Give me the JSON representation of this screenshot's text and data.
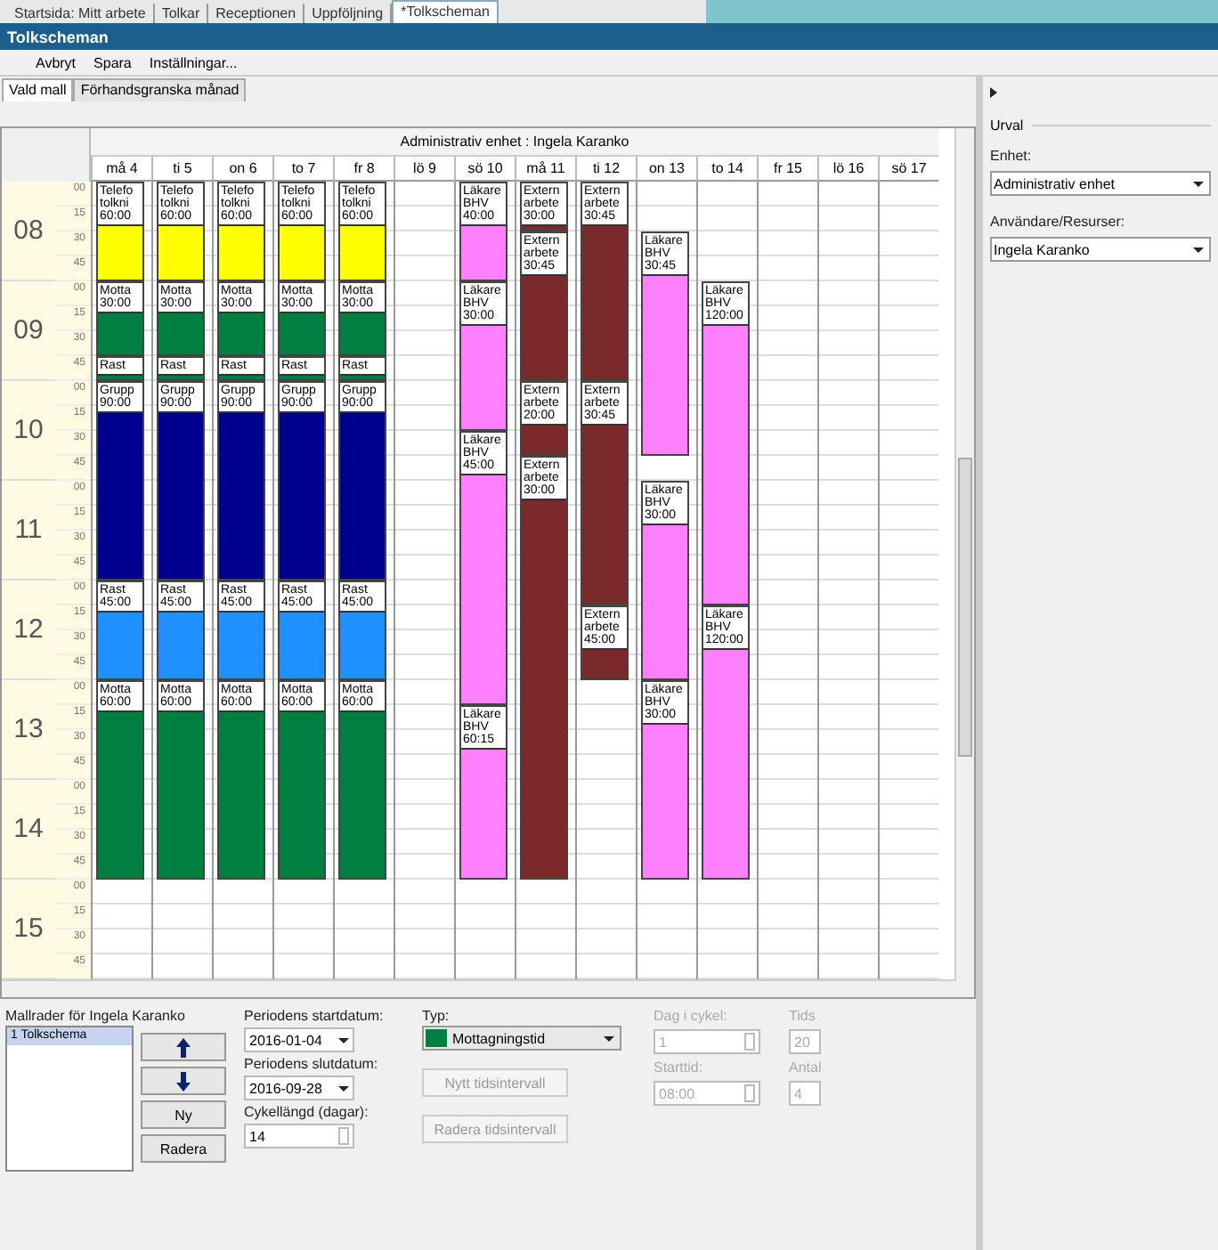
{
  "doc_tabs": [
    {
      "label": "Startsida: Mitt arbete",
      "selected": false
    },
    {
      "label": "Tolkar",
      "selected": false
    },
    {
      "label": "Receptionen",
      "selected": false
    },
    {
      "label": "Uppföljning",
      "selected": false
    },
    {
      "label": "*Tolkscheman",
      "selected": true
    }
  ],
  "window": {
    "title": "Tolkscheman"
  },
  "menu": [
    "Avbryt",
    "Spara",
    "Inställningar..."
  ],
  "sub_tabs": [
    {
      "label": "Vald mall",
      "selected": true
    },
    {
      "label": "Förhandsgranska månad",
      "selected": false
    }
  ],
  "calendar": {
    "header": "Administrativ enhet : Ingela Karanko",
    "hours": [
      {
        "label": "08",
        "minutes": [
          "00",
          "15",
          "30",
          "45"
        ]
      },
      {
        "label": "09",
        "minutes": [
          "00",
          "15",
          "30",
          "45"
        ]
      },
      {
        "label": "10",
        "minutes": [
          "00",
          "15",
          "30",
          "45"
        ]
      },
      {
        "label": "11",
        "minutes": [
          "00",
          "15",
          "30",
          "45"
        ]
      },
      {
        "label": "12",
        "minutes": [
          "00",
          "15",
          "30",
          "45"
        ]
      },
      {
        "label": "13",
        "minutes": [
          "00",
          "15",
          "30",
          "45"
        ]
      },
      {
        "label": "14",
        "minutes": [
          "00",
          "15",
          "30",
          "45"
        ]
      },
      {
        "label": "15",
        "minutes": [
          "00",
          "15",
          "30",
          "45"
        ]
      }
    ],
    "days": [
      {
        "label": "må 4",
        "events": [
          {
            "color": "#ffff00",
            "label": "Telefo\ntolkni\n60:00"
          },
          {
            "color": "#008040",
            "label": "Motta\n30:00"
          },
          {
            "color": "#008040",
            "label": "Rast"
          },
          {
            "color": "#000090",
            "label": "Grupp\n90:00"
          },
          {
            "color": "#1e90ff",
            "label": "Rast\n45:00"
          },
          {
            "color": "#008040",
            "label": "Motta\n60:00"
          }
        ]
      },
      {
        "label": "ti 5",
        "events": [
          {
            "color": "#ffff00",
            "label": "Telefo\ntolkni\n60:00"
          },
          {
            "color": "#008040",
            "label": "Motta\n30:00"
          },
          {
            "color": "#008040",
            "label": "Rast"
          },
          {
            "color": "#000090",
            "label": "Grupp\n90:00"
          },
          {
            "color": "#1e90ff",
            "label": "Rast\n45:00"
          },
          {
            "color": "#008040",
            "label": "Motta\n60:00"
          }
        ]
      },
      {
        "label": "on 6",
        "events": [
          {
            "color": "#ffff00",
            "label": "Telefo\ntolkni\n60:00"
          },
          {
            "color": "#008040",
            "label": "Motta\n30:00"
          },
          {
            "color": "#008040",
            "label": "Rast"
          },
          {
            "color": "#000090",
            "label": "Grupp\n90:00"
          },
          {
            "color": "#1e90ff",
            "label": "Rast\n45:00"
          },
          {
            "color": "#008040",
            "label": "Motta\n60:00"
          }
        ]
      },
      {
        "label": "to 7",
        "events": [
          {
            "color": "#ffff00",
            "label": "Telefo\ntolkni\n60:00"
          },
          {
            "color": "#008040",
            "label": "Motta\n30:00"
          },
          {
            "color": "#008040",
            "label": "Rast"
          },
          {
            "color": "#000090",
            "label": "Grupp\n90:00"
          },
          {
            "color": "#1e90ff",
            "label": "Rast\n45:00"
          },
          {
            "color": "#008040",
            "label": "Motta\n60:00"
          }
        ]
      },
      {
        "label": "fr 8",
        "events": [
          {
            "color": "#ffff00",
            "label": "Telefo\ntolkni\n60:00"
          },
          {
            "color": "#008040",
            "label": "Motta\n30:00"
          },
          {
            "color": "#008040",
            "label": "Rast"
          },
          {
            "color": "#000090",
            "label": "Grupp\n90:00"
          },
          {
            "color": "#1e90ff",
            "label": "Rast\n45:00"
          },
          {
            "color": "#008040",
            "label": "Motta\n60:00"
          }
        ]
      },
      {
        "label": "lö 9"
      },
      {
        "label": "sö 10",
        "events": [
          {
            "color": "#ff80ff",
            "label": "Läkare\nBHV\n40:00"
          },
          {
            "color": "#ff80ff",
            "label": "Läkare\nBHV\n30:00"
          },
          {
            "color": "#ff80ff",
            "label": "Läkare\nBHV\n45:00"
          },
          {
            "color": "#ff80ff",
            "label": "Läkare\nBHV\n60:15"
          }
        ]
      },
      {
        "label": "må 11",
        "events": [
          {
            "color": "#7b2a2a",
            "label": "Extern\narbete\n30:00"
          },
          {
            "color": "#7b2a2a",
            "label": "Extern\narbete\n30:45"
          },
          {
            "color": "#7b2a2a",
            "label": "Extern\narbete\n20:00"
          },
          {
            "color": "#7b2a2a",
            "label": "Extern\narbete\n30:00"
          }
        ]
      },
      {
        "label": "ti 12",
        "events": [
          {
            "color": "#7b2a2a",
            "label": "Extern\narbete\n30:45"
          },
          {
            "color": "#7b2a2a",
            "label": "Extern\narbete\n30:45"
          },
          {
            "color": "#7b2a2a",
            "label": "Extern\narbete\n45:00"
          }
        ]
      },
      {
        "label": "on 13",
        "events": [
          {
            "color": "#ff80ff",
            "label": "Läkare\nBHV\n30:45"
          },
          {
            "color": "#ff80ff",
            "label": "Läkare\nBHV\n30:00"
          },
          {
            "color": "#ff80ff",
            "label": "Läkare\nBHV\n30:00"
          }
        ]
      },
      {
        "label": "to 14",
        "events": [
          {
            "color": "#ff80ff",
            "label": "Läkare\nBHV\n120:00"
          },
          {
            "color": "#ff80ff",
            "label": "Läkare\nBHV\n120:00"
          }
        ]
      },
      {
        "label": "fr 15"
      },
      {
        "label": "lö 16"
      },
      {
        "label": "sö 17"
      }
    ]
  },
  "template_rows": {
    "label": "Mallrader för Ingela Karanko",
    "items": [
      {
        "label": "1 Tolkschema",
        "selected": true
      }
    ],
    "buttons": [
      "Ny",
      "Radera"
    ]
  },
  "period": {
    "start_label": "Periodens startdatum:",
    "start": "2016-01-04",
    "end_label": "Periodens slutdatum:",
    "end": "2016-09-28",
    "cycle_label": "Cykellängd (dagar):",
    "cycle": "14"
  },
  "type": {
    "label": "Typ:",
    "value": "Mottagningstid",
    "color": "#008040"
  },
  "interval_buttons": [
    {
      "label": "Nytt tidsintervall",
      "disabled": true
    },
    {
      "label": "Radera tidsintervall",
      "disabled": true
    }
  ],
  "interval_fields": [
    {
      "label": "Dag i cykel:",
      "value": "1",
      "disabled": true
    },
    {
      "label": "Starttid:",
      "value": "08:00",
      "disabled": true
    }
  ],
  "cut_fields": [
    {
      "label": "Tids",
      "value": "20",
      "disabled": true
    },
    {
      "label": "Antal",
      "value": "4",
      "disabled": true
    }
  ],
  "selection": {
    "title": "Urval",
    "unit_label": "Enhet:",
    "unit": "Administrativ enhet",
    "users_label": "Användare/Resurser:",
    "user": "Ingela Karanko"
  }
}
